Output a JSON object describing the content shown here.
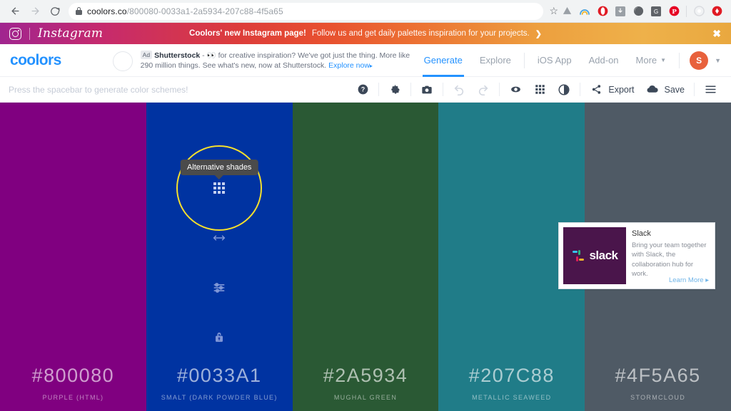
{
  "browser": {
    "back_icon": "back-arrow-icon",
    "forward_icon": "forward-arrow-icon",
    "reload_icon": "reload-icon",
    "url_domain": "coolors.co",
    "url_path": "/800080-0033a1-2a5934-207c88-4f5a65",
    "star_glyph": "☆"
  },
  "promo": {
    "brand": "Instagram",
    "headline": "Coolors' new Instagram page!",
    "subtext": "Follow us and get daily palettes inspiration for your projects.",
    "arrow": "❯",
    "close": "✖"
  },
  "header": {
    "brand": "coolors",
    "ad": {
      "tag": "Ad",
      "advertiser": "Shutterstock",
      "separator": "-",
      "emoji": "👀",
      "body": "for creative inspiration? We've got just the thing. More like 290 million things. See what's new, now at Shutterstock.",
      "cta": "Explore now",
      "cta_arrow": "▸"
    },
    "nav": [
      {
        "label": "Generate",
        "active": true
      },
      {
        "label": "Explore",
        "active": false
      },
      {
        "label": "iOS App",
        "active": false
      },
      {
        "label": "Add-on",
        "active": false
      },
      {
        "label": "More",
        "active": false,
        "caret": "▼"
      }
    ],
    "avatar_initial": "S",
    "avatar_caret": "▼",
    "avatar_color": "#e8613c"
  },
  "toolbar": {
    "hint": "Press the spacebar to generate color schemes!",
    "help_icon": "help-circle-icon",
    "settings_icon": "gear-icon",
    "camera_icon": "camera-icon",
    "undo_icon": "undo-icon",
    "redo_icon": "redo-icon",
    "view_icon": "eye-icon",
    "grid_icon": "grid-icon",
    "contrast_icon": "contrast-icon",
    "share_icon": "share-icon",
    "export_label": "Export",
    "save_icon": "cloud-icon",
    "save_label": "Save",
    "menu_icon": "hamburger-menu-icon"
  },
  "palette": {
    "tooltip": "Alternative shades",
    "highlight_color": "#f5e02c",
    "swatches": [
      {
        "hex": "#800080",
        "name": "PURPLE (HTML)",
        "active": false
      },
      {
        "hex": "#0033A1",
        "name": "SMALT (DARK POWDER BLUE)",
        "active": true
      },
      {
        "hex": "#2A5934",
        "name": "MUGHAL GREEN",
        "active": false
      },
      {
        "hex": "#207C88",
        "name": "METALLIC SEAWEED",
        "active": false
      },
      {
        "hex": "#4F5A65",
        "name": "STORMCLOUD",
        "active": false
      }
    ],
    "swatch_icons": {
      "shades": "grid-icon",
      "drag": "horizontal-resize-icon",
      "adjust": "sliders-icon",
      "lock": "unlocked-padlock-icon"
    }
  },
  "ad_card": {
    "logo_text": "slack",
    "title": "Slack",
    "description": "Bring your team together with Slack, the collaboration hub for work.",
    "cta": "Learn More",
    "cta_arrow": "▸",
    "logo_bg": "#4a154b"
  }
}
